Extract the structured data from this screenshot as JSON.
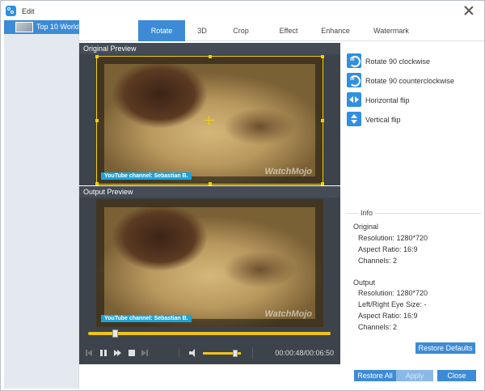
{
  "window": {
    "title": "Edit"
  },
  "sidebar": {
    "items": [
      {
        "label": "Top 10 World'..."
      }
    ]
  },
  "tabs": [
    {
      "label": "Rotate",
      "active": true
    },
    {
      "label": "3D"
    },
    {
      "label": "Crop"
    },
    {
      "label": "Effect"
    },
    {
      "label": "Enhance"
    },
    {
      "label": "Watermark"
    }
  ],
  "original_preview": {
    "title": "Original Preview",
    "caption": "YouTube channel: Sebastian B.",
    "watermark": "WatchMojo"
  },
  "output_preview": {
    "title": "Output Preview",
    "caption": "YouTube channel: Sebastian B.",
    "watermark": "WatchMojo"
  },
  "player": {
    "time": "00:00:48/00:06:50",
    "progress": 0.1,
    "volume": 0.85
  },
  "actions": [
    {
      "label": "Rotate 90 clockwise",
      "icon": "rotate-cw-icon",
      "badge": "90"
    },
    {
      "label": "Rotate 90 counterclockwise",
      "icon": "rotate-ccw-icon",
      "badge": "90"
    },
    {
      "label": "Horizontal flip",
      "icon": "horizontal-flip-icon"
    },
    {
      "label": "Vertical flip",
      "icon": "vertical-flip-icon"
    }
  ],
  "info": {
    "title": "Info",
    "original": {
      "title": "Original",
      "resolution": "Resolution: 1280*720",
      "aspect_ratio": "Aspect Ratio: 16:9",
      "channels": "Channels: 2"
    },
    "output": {
      "title": "Output",
      "resolution": "Resolution: 1280*720",
      "eye_size": "Left/Right Eye Size: -",
      "aspect_ratio": "Aspect Ratio: 16:9",
      "channels": "Channels: 2"
    }
  },
  "buttons": {
    "restore_defaults": "Restore Defaults",
    "restore_all": "Restore All",
    "apply": "Apply",
    "close": "Close"
  },
  "colors": {
    "accent": "#3d8bd6",
    "crop_frame": "#f5d000",
    "seek_bar": "#f0c419"
  }
}
